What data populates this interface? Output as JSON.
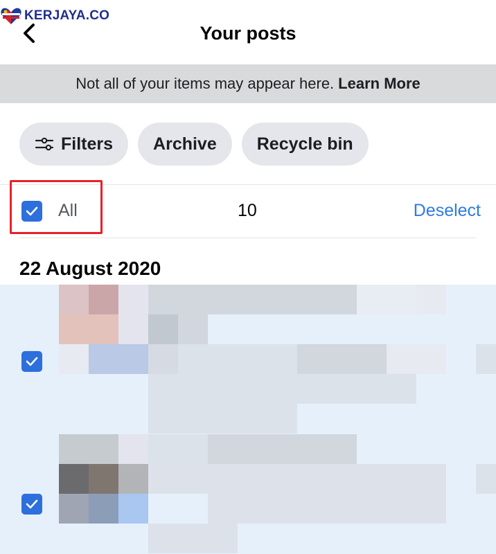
{
  "watermark": {
    "text": "KERJAYA.CO"
  },
  "header": {
    "title": "Your posts",
    "back_icon": "chevron-left-icon"
  },
  "notice": {
    "text": "Not all of your items may appear here.",
    "link": "Learn More"
  },
  "chips": [
    {
      "label": "Filters",
      "icon": "filter-sliders-icon"
    },
    {
      "label": "Archive"
    },
    {
      "label": "Recycle bin"
    }
  ],
  "selection": {
    "all_label": "All",
    "count": "10",
    "deselect_label": "Deselect",
    "checked": true
  },
  "date_group": {
    "date": "22 August 2020"
  },
  "posts": [
    {
      "checked": true
    },
    {
      "checked": true
    }
  ],
  "colors": {
    "accent": "#2d6fdc",
    "link": "#2d7be0",
    "highlight_border": "#e8202a",
    "selected_bg": "#e6f0fb"
  }
}
